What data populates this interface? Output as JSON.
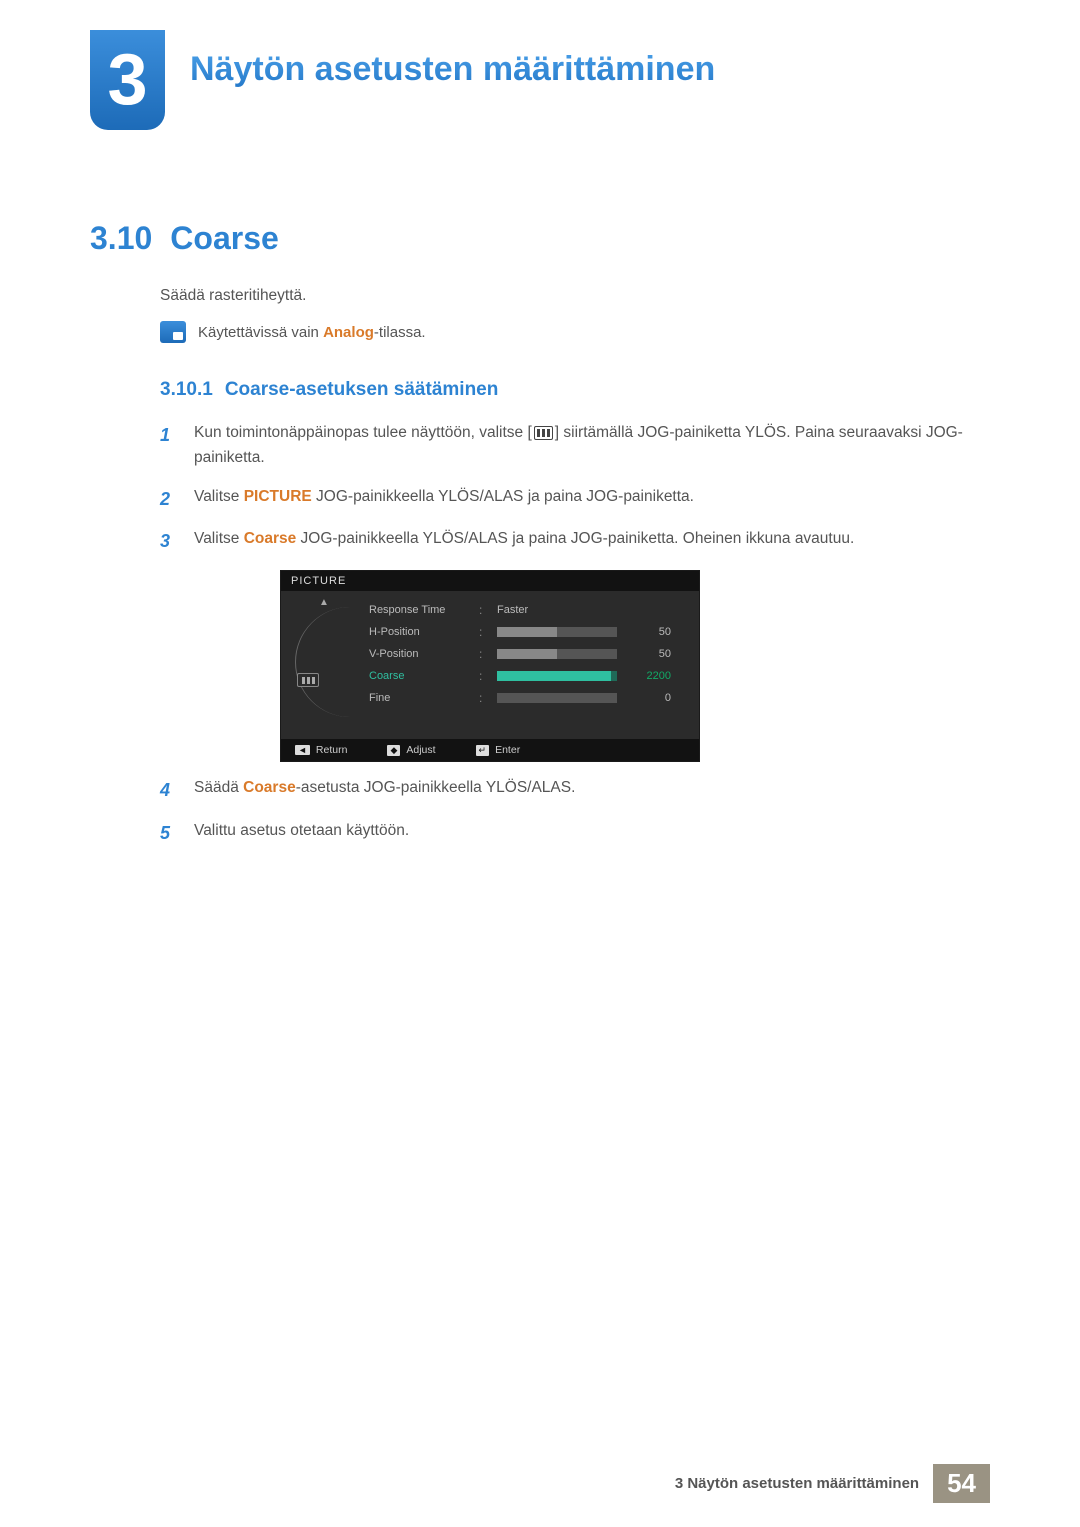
{
  "chapter": {
    "number": "3",
    "title": "Näytön asetusten määrittäminen"
  },
  "section": {
    "number": "3.10",
    "title": "Coarse"
  },
  "intro": "Säädä rasteritiheyttä.",
  "note": {
    "pre": "Käytettävissä vain ",
    "hl": "Analog",
    "post": "-tilassa."
  },
  "subsection": {
    "number": "3.10.1",
    "title": "Coarse-asetuksen säätäminen"
  },
  "steps": {
    "s1": {
      "n": "1",
      "a": "Kun toimintonäppäinopas tulee näyttöön, valitse [",
      "b": "] siirtämällä JOG-painiketta YLÖS. Paina seuraavaksi JOG-painiketta."
    },
    "s2": {
      "n": "2",
      "a": "Valitse ",
      "hl": "PICTURE",
      "b": " JOG-painikkeella YLÖS/ALAS ja paina JOG-painiketta."
    },
    "s3": {
      "n": "3",
      "a": "Valitse ",
      "hl": "Coarse",
      "b": " JOG-painikkeella YLÖS/ALAS ja paina JOG-painiketta. Oheinen ikkuna avautuu."
    },
    "s4": {
      "n": "4",
      "a": "Säädä ",
      "hl": "Coarse",
      "b": "-asetusta JOG-painikkeella YLÖS/ALAS."
    },
    "s5": {
      "n": "5",
      "a": "Valittu asetus otetaan käyttöön."
    }
  },
  "osd": {
    "title": "PICTURE",
    "rows": {
      "response": {
        "label": "Response Time",
        "value": "Faster"
      },
      "hpos": {
        "label": "H-Position",
        "num": "50",
        "fill": 50
      },
      "vpos": {
        "label": "V-Position",
        "num": "50",
        "fill": 50
      },
      "coarse": {
        "label": "Coarse",
        "num": "2200",
        "fill": 95
      },
      "fine": {
        "label": "Fine",
        "num": "0",
        "fill": 0
      }
    },
    "footer": {
      "return": "Return",
      "adjust": "Adjust",
      "enter": "Enter"
    }
  },
  "footer": {
    "text": "3 Näytön asetusten määrittäminen",
    "page": "54"
  }
}
